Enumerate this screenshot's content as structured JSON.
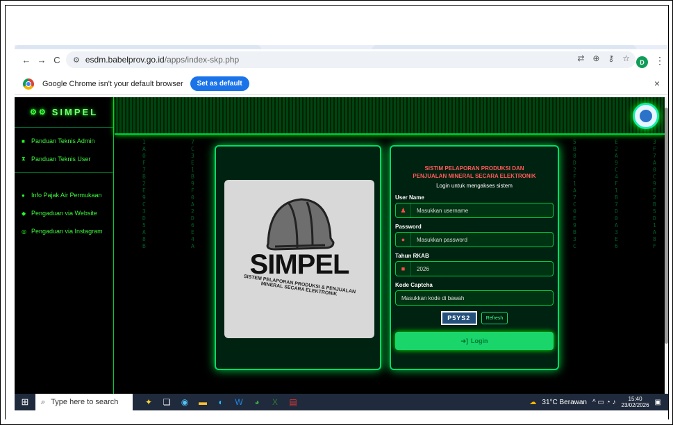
{
  "browser": {
    "url_host": "esdm.babelprov.go.id",
    "url_path": "/apps/index-skp.php",
    "profile_initial": "D",
    "nav": {
      "back": "←",
      "forward": "→",
      "reload": "C"
    },
    "infobar_text": "Google Chrome isn't your default browser",
    "infobar_button": "Set as default",
    "infobar_close": "×"
  },
  "sidebar": {
    "brand": "SIMPEL",
    "items": [
      {
        "label": "Panduan Teknis Admin",
        "icon": "book-icon"
      },
      {
        "label": "Panduan Teknis User",
        "icon": "hourglass-icon"
      },
      {
        "label": "Info Pajak Air Permukaan",
        "icon": "water-drop-icon"
      },
      {
        "label": "Pengaduan via Website",
        "icon": "chat-icon"
      },
      {
        "label": "Pengaduan via Instagram",
        "icon": "instagram-icon"
      }
    ]
  },
  "logo": {
    "word": "SIMPEL",
    "sub": "SISTEM PELAPORAN PRODUKSI & PENJUALAN MINERAL SECARA ELEKTRONIK"
  },
  "login": {
    "title_line1": "SISTIM PELAPORAN PRODUKSI DAN",
    "title_line2": "PENJUALAN MINERAL SECARA ELEKTRONIK",
    "subtitle": "Login untuk mengakses sistem",
    "username_label": "User Name",
    "username_placeholder": "Masukkan username",
    "password_label": "Password",
    "password_placeholder": "Masukkan password",
    "year_label": "Tahun RKAB",
    "year_value": "2026",
    "captcha_label": "Kode Captcha",
    "captcha_placeholder": "Masukkan kode di bawah",
    "captcha_code": "P5YS2",
    "refresh_label": "Refresh",
    "login_button": "Login"
  },
  "taskbar": {
    "search_placeholder": "Type here to search",
    "weather": "31°C Berawan",
    "time": "15:40",
    "date": "23/02/2026"
  },
  "colors": {
    "accent_green": "#19d56a",
    "neon": "#00ff66",
    "title_red": "#ff5b5b",
    "captcha_blue": "#25507c"
  }
}
